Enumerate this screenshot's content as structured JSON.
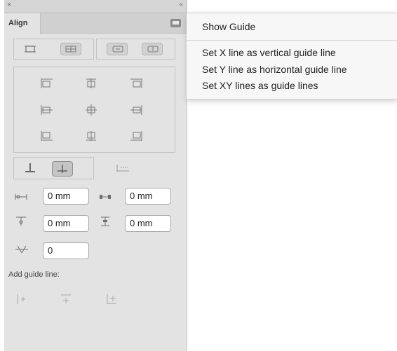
{
  "panel": {
    "close_glyph": "×",
    "collapse_glyph": "‹‹",
    "tab_label": "Align",
    "icons": {
      "menu": "panel-menu-icon",
      "collapse": "double-chevron-icon"
    }
  },
  "fields": {
    "horizontal_spacing": "0 mm",
    "horizontal_distance": "0 mm",
    "vertical_spacing": "0 mm",
    "vertical_distance": "0 mm",
    "rotation": "0"
  },
  "add_guide_line_label": "Add guide line:",
  "menu": {
    "items": [
      "Show Guide",
      "Set X line as vertical guide line",
      "Set Y line as horizontal guide line",
      "Set XY lines as guide lines"
    ]
  },
  "colors": {
    "panel_bg": "#e3e3e3",
    "menu_bg": "#f7f7f7",
    "icon": "#7a7a7a"
  }
}
